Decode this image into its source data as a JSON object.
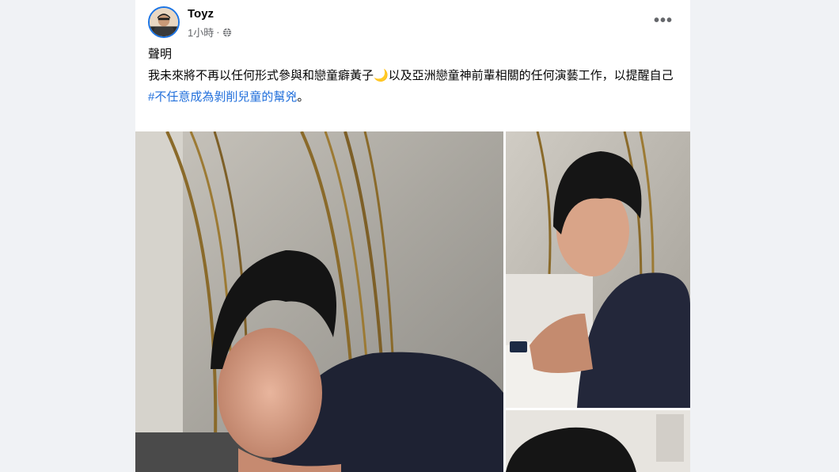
{
  "post": {
    "author": "Toyz",
    "time": "1小時",
    "separator": "·",
    "privacy_icon": "globe-icon",
    "more_icon": "more-options-icon",
    "more_label": "•••",
    "title_line": "聲明",
    "body_line": "我未來將不再以任何形式參與和戀童癖黃子🌙以及亞洲戀童神前輩相關的任何演藝工作，以提醒自己",
    "hashtag": "#不任意成為剝削兒童的幫兇",
    "hashtag_suffix": "。"
  },
  "photos": [
    {
      "name": "photo-main",
      "description_icon": "photo-icon"
    },
    {
      "name": "photo-side-1",
      "description_icon": "photo-icon"
    },
    {
      "name": "photo-side-2",
      "description_icon": "photo-icon"
    }
  ],
  "colors": {
    "page_bg": "#f0f2f5",
    "card_bg": "#ffffff",
    "text": "#050505",
    "secondary_text": "#65676b",
    "link": "#216fdb",
    "avatar_ring": "#1b74e4"
  }
}
